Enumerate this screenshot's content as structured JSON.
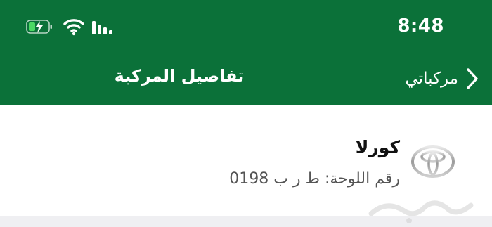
{
  "status_bar": {
    "time": "8:48"
  },
  "nav": {
    "title": "تفاصيل المركبة",
    "back_label": "مركباتي"
  },
  "vehicle": {
    "name": "كورلا",
    "plate_label": "رقم اللوحة:",
    "plate_value": "ط ر ب 0198",
    "brand_icon": "toyota-logo"
  },
  "colors": {
    "header_bg": "#0b7139",
    "text_primary": "#111111",
    "text_secondary": "#555555"
  }
}
